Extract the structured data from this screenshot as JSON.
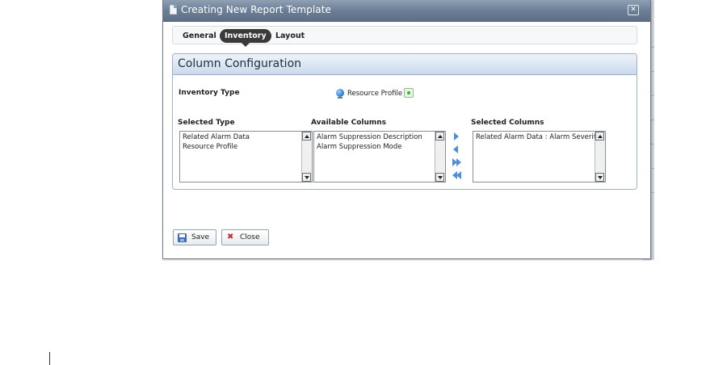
{
  "dialog": {
    "title": "Creating New Report Template",
    "close_glyph": "✕"
  },
  "tabs": [
    {
      "label": "General"
    },
    {
      "label": "Inventory",
      "active": true
    },
    {
      "label": "Layout"
    }
  ],
  "panel": {
    "title": "Column Configuration",
    "inventory_type_label": "Inventory Type",
    "inventory_type_value": "Resource Profile",
    "selected_type_label": "Selected Type",
    "available_columns_label": "Available Columns",
    "selected_columns_label": "Selected Columns",
    "selected_type_items": [
      "Related Alarm Data",
      "Resource Profile"
    ],
    "available_columns_items": [
      "Alarm Suppression Description",
      "Alarm Suppression Mode"
    ],
    "selected_columns_items": [
      "Related Alarm Data : Alarm Severity"
    ]
  },
  "buttons": {
    "save": "Save",
    "close": "Close"
  },
  "icons": {
    "title": "document-icon",
    "inventory_type": "globe-icon",
    "add": "add-icon",
    "move_right": "arrow-right-icon",
    "move_left": "arrow-left-icon",
    "move_all_right": "double-arrow-right-icon",
    "move_all_left": "double-arrow-left-icon",
    "save": "floppy-disk-icon",
    "close": "red-x-icon"
  },
  "colors": {
    "titlebar": "#6c7f97",
    "panel_header": "#dbe6f4",
    "active_tab": "#3a3a3a",
    "arrow": "#4f8fd6"
  }
}
